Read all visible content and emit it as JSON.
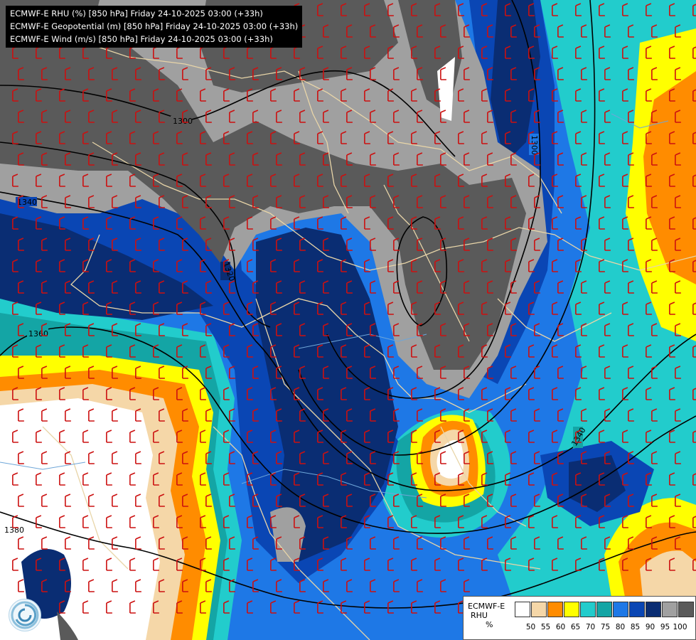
{
  "header": {
    "lines": [
      "ECMWF-E RHU (%) [850 hPa] Friday 24-10-2025 03:00 (+33h)",
      "ECMWF-E Geopotential (m) [850 hPa] Friday 24-10-2025 03:00 (+33h)",
      "ECMWF-E Wind (m/s) [850 hPa] Friday 24-10-2025 03:00 (+33h)"
    ]
  },
  "contours": {
    "labels": [
      "1300",
      "1300",
      "1320",
      "1340",
      "1340",
      "1360",
      "1380"
    ]
  },
  "legend": {
    "title_line1": "ECMWF-E",
    "title_line2": "RHU",
    "title_line3": "%",
    "ticks": [
      "50",
      "55",
      "60",
      "65",
      "70",
      "75",
      "80",
      "85",
      "90",
      "95",
      "100"
    ],
    "colors": [
      "#ffffff",
      "#f5d7a8",
      "#ff8c00",
      "#ffff00",
      "#22cccc",
      "#14a5a5",
      "#1e78e6",
      "#0a46b4",
      "#0a2d73",
      "#a0a0a0",
      "#5a5a5a"
    ]
  },
  "colors": {
    "rh_lt50": "#ffffff",
    "rh_50": "#f5d7a8",
    "rh_55": "#ff8c00",
    "rh_60": "#ffff00",
    "rh_65": "#22cccc",
    "rh_70": "#14a5a5",
    "rh_75": "#1e78e6",
    "rh_80": "#0a46b4",
    "rh_85": "#0a2d73",
    "rh_90": "#a0a0a0",
    "rh_95": "#5a5a5a",
    "wind_barb": "#cc1010",
    "borders": "#e8d5a8"
  }
}
